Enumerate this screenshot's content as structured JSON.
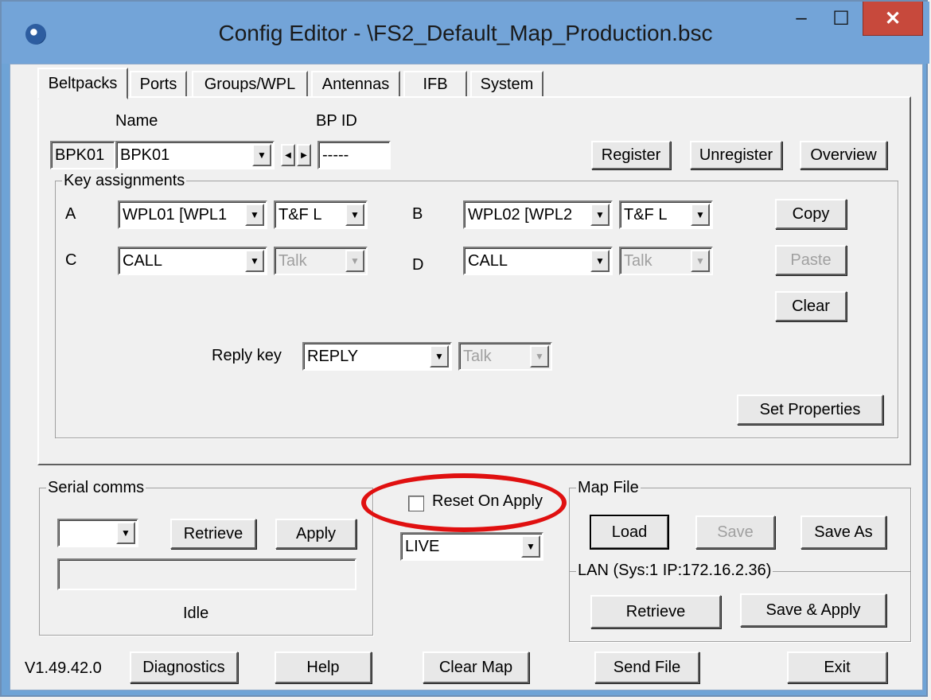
{
  "window": {
    "title": "Config Editor - \\FS2_Default_Map_Production.bsc",
    "minimize": "–",
    "maximize": "☐",
    "close": "✕"
  },
  "tabs": [
    "Beltpacks",
    "Ports",
    "Groups/WPL",
    "Antennas",
    "IFB",
    "System"
  ],
  "beltpack": {
    "name_label": "Name",
    "bpid_label": "BP ID",
    "code": "BPK01",
    "name_value": "BPK01",
    "bpid_value": "-----",
    "register": "Register",
    "unregister": "Unregister",
    "overview": "Overview"
  },
  "keys": {
    "group_title": "Key assignments",
    "a_label": "A",
    "a_value": "WPL01 [WPL1",
    "a_mode": "T&F L",
    "b_label": "B",
    "b_value": "WPL02 [WPL2",
    "b_mode": "T&F L",
    "c_label": "C",
    "c_value": "CALL",
    "c_mode": "Talk",
    "d_label": "D",
    "d_value": "CALL",
    "d_mode": "Talk",
    "copy": "Copy",
    "paste": "Paste",
    "clear": "Clear",
    "reply_label": "Reply key",
    "reply_value": "REPLY",
    "reply_mode": "Talk",
    "set_properties": "Set Properties"
  },
  "serial": {
    "group_title": "Serial comms",
    "port_value": "",
    "retrieve": "Retrieve",
    "apply": "Apply",
    "status": "Idle"
  },
  "reset": {
    "label": "Reset On Apply",
    "mode_value": "LIVE"
  },
  "mapfile": {
    "group_title": "Map File",
    "load": "Load",
    "save": "Save",
    "save_as": "Save As",
    "lan_title": "LAN  (Sys:1 IP:172.16.2.36)",
    "retrieve": "Retrieve",
    "save_apply": "Save & Apply"
  },
  "footer": {
    "version": "V1.49.42.0",
    "diagnostics": "Diagnostics",
    "help": "Help",
    "clear_map": "Clear Map",
    "send_file": "Send File",
    "exit": "Exit"
  }
}
